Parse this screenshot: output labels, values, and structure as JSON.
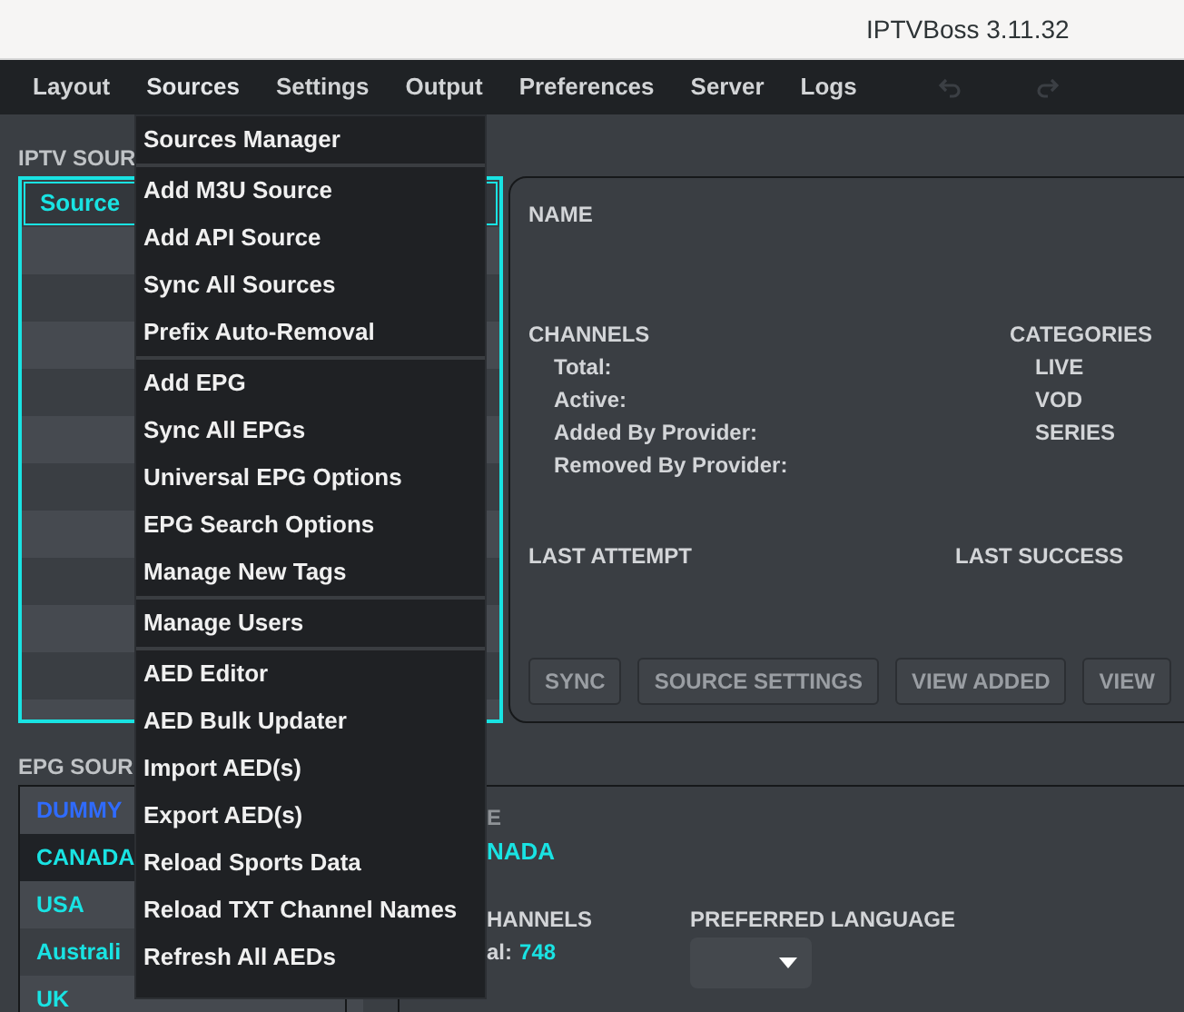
{
  "window": {
    "title": "IPTVBoss 3.11.32"
  },
  "menubar": [
    {
      "label": "Layout",
      "selected": false
    },
    {
      "label": "Sources",
      "selected": true
    },
    {
      "label": "Settings",
      "selected": false
    },
    {
      "label": "Output",
      "selected": false
    },
    {
      "label": "Preferences",
      "selected": false
    },
    {
      "label": "Server",
      "selected": false
    },
    {
      "label": "Logs",
      "selected": false
    }
  ],
  "toolbar": {
    "undo_disabled": true,
    "redo_disabled": true
  },
  "sources_menu": [
    [
      "Sources Manager"
    ],
    [
      "Add M3U Source",
      "Add API Source",
      "Sync All Sources",
      "Prefix Auto-Removal"
    ],
    [
      "Add EPG",
      "Sync All EPGs",
      "Universal EPG Options",
      "EPG Search Options",
      "Manage New Tags"
    ],
    [
      "Manage Users"
    ],
    [
      "AED Editor",
      "AED Bulk Updater",
      "Import AED(s)",
      "Export AED(s)",
      "Reload Sports Data",
      "Reload TXT Channel Names",
      "Refresh All AEDs"
    ]
  ],
  "iptv_sources": {
    "heading": "IPTV SOUR",
    "column": "Source"
  },
  "source_details": {
    "name_label": "NAME",
    "channels_label": "CHANNELS",
    "channel_stats": [
      "Total:",
      "Active:",
      "Added By Provider:",
      "Removed By Provider:"
    ],
    "categories_label": "CATEGORIES",
    "categories": [
      "LIVE",
      "VOD",
      "SERIES"
    ],
    "last_attempt_label": "LAST ATTEMPT",
    "last_success_label": "LAST SUCCESS",
    "buttons": [
      {
        "label": "SYNC",
        "disabled": true
      },
      {
        "label": "SOURCE SETTINGS",
        "disabled": true
      },
      {
        "label": "VIEW ADDED",
        "disabled": true
      },
      {
        "label": "VIEW",
        "disabled": true
      }
    ]
  },
  "epg_sources": {
    "heading": "EPG SOUR",
    "items": [
      {
        "label": "DUMMY",
        "color": "#2f6bff",
        "selected": false
      },
      {
        "label": "CANADA",
        "color": "#19e3e3",
        "selected": true
      },
      {
        "label": "USA",
        "color": "#19e3e3",
        "selected": false
      },
      {
        "label": "Australi",
        "color": "#19e3e3",
        "selected": false
      },
      {
        "label": "UK",
        "color": "#19e3e3",
        "selected": false
      }
    ]
  },
  "epg_details": {
    "name_label": "E",
    "name_value": "NADA",
    "channels_label": "HANNELS",
    "total_label": "al:",
    "total_value": "748",
    "language_label": "PREFERRED LANGUAGE"
  }
}
